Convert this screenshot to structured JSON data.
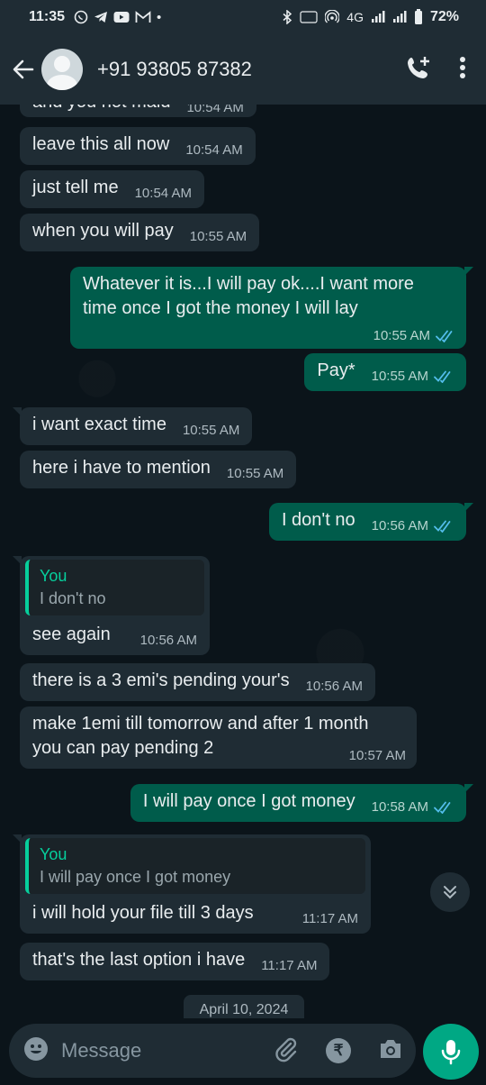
{
  "status_bar": {
    "time": "11:35",
    "notif_icons": [
      "whatsapp-icon",
      "telegram-icon",
      "youtube-icon",
      "gmail-icon"
    ],
    "dot": "•",
    "network_label": "4G",
    "battery": "72%"
  },
  "header": {
    "contact": "+91 93805 87382"
  },
  "messages": [
    {
      "dir": "in",
      "text": "and you not maid",
      "time": "10:54 AM"
    },
    {
      "dir": "in",
      "text": "leave this all now",
      "time": "10:54 AM"
    },
    {
      "dir": "in",
      "text": "just tell me",
      "time": "10:54 AM"
    },
    {
      "dir": "in",
      "text": "when you will pay",
      "time": "10:55 AM"
    },
    {
      "dir": "out",
      "text": "Whatever it is...I will pay ok....I want more time once I got the money I will lay",
      "time": "10:55 AM"
    },
    {
      "dir": "out",
      "text": "Pay*",
      "time": "10:55 AM"
    },
    {
      "dir": "in",
      "text": "i want exact time",
      "time": "10:55 AM"
    },
    {
      "dir": "in",
      "text": "here i have to mention",
      "time": "10:55 AM"
    },
    {
      "dir": "out",
      "text": "I don't no",
      "time": "10:56 AM"
    },
    {
      "dir": "in",
      "quote_author": "You",
      "quote_text": "I don't no",
      "text": "see again",
      "time": "10:56 AM"
    },
    {
      "dir": "in",
      "text": "there is a 3 emi's pending your's",
      "time": "10:56 AM"
    },
    {
      "dir": "in",
      "text": "make 1emi till tomorrow and after 1 month you can pay pending 2",
      "time": "10:57 AM"
    },
    {
      "dir": "out",
      "text": "I will pay once I got money",
      "time": "10:58 AM"
    },
    {
      "dir": "in",
      "quote_author": "You",
      "quote_text": "I will pay once I got money",
      "text": "i will hold your file till 3 days",
      "time": "11:17 AM"
    },
    {
      "dir": "in",
      "text": "that's the last option i have",
      "time": "11:17 AM"
    }
  ],
  "date_chip": "April 10, 2024",
  "composer": {
    "placeholder": "Message",
    "rupee_symbol": "₹"
  },
  "colors": {
    "incoming_bubble": "#1f2c34",
    "outgoing_bubble": "#005c4b",
    "accent": "#00a884",
    "read_tick": "#53bdeb"
  }
}
